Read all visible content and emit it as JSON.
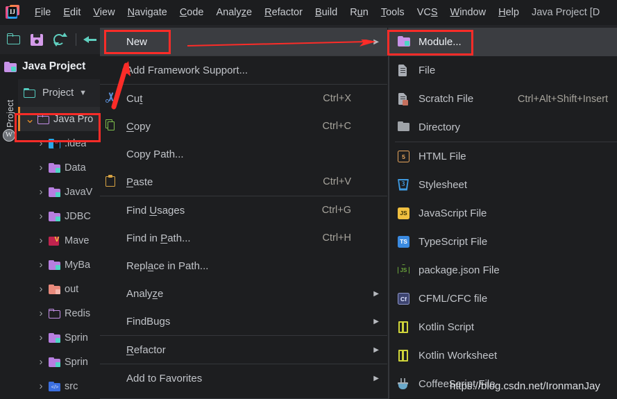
{
  "app": {
    "logo_icon": "intellij-idea-logo",
    "window_title": "Java Project [D"
  },
  "menubar": {
    "items": [
      {
        "label": "File",
        "mnemonic": "F"
      },
      {
        "label": "Edit",
        "mnemonic": "E"
      },
      {
        "label": "View",
        "mnemonic": "V"
      },
      {
        "label": "Navigate",
        "mnemonic": "N"
      },
      {
        "label": "Code",
        "mnemonic": "C"
      },
      {
        "label": "Analyze",
        "mnemonic": "z"
      },
      {
        "label": "Refactor",
        "mnemonic": "R"
      },
      {
        "label": "Build",
        "mnemonic": "B"
      },
      {
        "label": "Run",
        "mnemonic": "u"
      },
      {
        "label": "Tools",
        "mnemonic": "T"
      },
      {
        "label": "VCS",
        "mnemonic": "S"
      },
      {
        "label": "Window",
        "mnemonic": "W"
      },
      {
        "label": "Help",
        "mnemonic": "H"
      }
    ]
  },
  "toolbar": {
    "icons": [
      {
        "name": "open-folder-icon"
      },
      {
        "name": "save-all-icon"
      },
      {
        "name": "sync-refresh-icon"
      },
      {
        "name": "back-arrow-icon"
      }
    ]
  },
  "project_header": {
    "icon": "module-folder-icon",
    "label": "Java Project"
  },
  "left_strip": {
    "vertical_label": "1: Project",
    "avatar_icon": "user-avatar-icon"
  },
  "tree_toolbar": {
    "icon": "project-view-icon",
    "label": "Project",
    "chevron_icon": "chevron-down-icon"
  },
  "project_tree": {
    "rows": [
      {
        "label": "Java Pro",
        "icon": "folder-outline-purple",
        "expanded": true,
        "selected": true,
        "indent": 10
      },
      {
        "label": ".idea",
        "icon": "idea-folder",
        "expanded": false,
        "selected": false,
        "indent": 26
      },
      {
        "label": "Data",
        "icon": "folder-module-purple",
        "expanded": false,
        "selected": false,
        "indent": 26
      },
      {
        "label": "JavaV",
        "icon": "folder-module-purple",
        "expanded": false,
        "selected": false,
        "indent": 26
      },
      {
        "label": "JDBC",
        "icon": "folder-module-purple",
        "expanded": false,
        "selected": false,
        "indent": 26
      },
      {
        "label": "Mave",
        "icon": "maven-folder",
        "expanded": false,
        "selected": false,
        "indent": 26
      },
      {
        "label": "MyBa",
        "icon": "folder-module-purple",
        "expanded": false,
        "selected": false,
        "indent": 26
      },
      {
        "label": "out",
        "icon": "folder-out-salmon",
        "expanded": false,
        "selected": false,
        "indent": 26
      },
      {
        "label": "Redis",
        "icon": "folder-outline-purple",
        "expanded": false,
        "selected": false,
        "indent": 26
      },
      {
        "label": "Sprin",
        "icon": "folder-module-purple",
        "expanded": false,
        "selected": false,
        "indent": 26
      },
      {
        "label": "Sprin",
        "icon": "folder-module-purple",
        "expanded": false,
        "selected": false,
        "indent": 26
      },
      {
        "label": "src",
        "icon": "folder-source-blue",
        "expanded": false,
        "selected": false,
        "indent": 26
      }
    ]
  },
  "context_menu": {
    "items": [
      {
        "label": "New",
        "icon": null,
        "shortcut": "",
        "submenu": true,
        "highlighted": true,
        "sep_after": true,
        "mnemonic": ""
      },
      {
        "label": "Add Framework Support...",
        "icon": null,
        "shortcut": "",
        "submenu": false,
        "highlighted": false,
        "sep_after": true,
        "mnemonic": ""
      },
      {
        "label": "Cut",
        "icon": "cut-icon",
        "shortcut": "Ctrl+X",
        "submenu": false,
        "highlighted": false,
        "sep_after": false,
        "mnemonic": "t"
      },
      {
        "label": "Copy",
        "icon": "copy-icon",
        "shortcut": "Ctrl+C",
        "submenu": false,
        "highlighted": false,
        "sep_after": false,
        "mnemonic": "C"
      },
      {
        "label": "Copy Path...",
        "icon": null,
        "shortcut": "",
        "submenu": false,
        "highlighted": false,
        "sep_after": false,
        "mnemonic": ""
      },
      {
        "label": "Paste",
        "icon": "paste-icon",
        "shortcut": "Ctrl+V",
        "submenu": false,
        "highlighted": false,
        "sep_after": true,
        "mnemonic": "P"
      },
      {
        "label": "Find Usages",
        "icon": null,
        "shortcut": "Ctrl+G",
        "submenu": false,
        "highlighted": false,
        "sep_after": false,
        "mnemonic": "U"
      },
      {
        "label": "Find in Path...",
        "icon": null,
        "shortcut": "Ctrl+H",
        "submenu": false,
        "highlighted": false,
        "sep_after": false,
        "mnemonic": "P"
      },
      {
        "label": "Replace in Path...",
        "icon": null,
        "shortcut": "",
        "submenu": false,
        "highlighted": false,
        "sep_after": false,
        "mnemonic": "a"
      },
      {
        "label": "Analyze",
        "icon": null,
        "shortcut": "",
        "submenu": true,
        "highlighted": false,
        "sep_after": false,
        "mnemonic": "z"
      },
      {
        "label": "FindBugs",
        "icon": null,
        "shortcut": "",
        "submenu": true,
        "highlighted": false,
        "sep_after": true,
        "mnemonic": ""
      },
      {
        "label": "Refactor",
        "icon": null,
        "shortcut": "",
        "submenu": true,
        "highlighted": false,
        "sep_after": true,
        "mnemonic": "R"
      },
      {
        "label": "Add to Favorites",
        "icon": null,
        "shortcut": "",
        "submenu": true,
        "highlighted": false,
        "sep_after": false,
        "mnemonic": ""
      }
    ]
  },
  "new_submenu": {
    "items": [
      {
        "label": "Module...",
        "icon": "module-folder-icon",
        "shortcut": "",
        "highlighted": true,
        "sep_after": false
      },
      {
        "label": "File",
        "icon": "file-icon",
        "shortcut": "",
        "highlighted": false,
        "sep_after": false
      },
      {
        "label": "Scratch File",
        "icon": "scratch-file-icon",
        "shortcut": "Ctrl+Alt+Shift+Insert",
        "highlighted": false,
        "sep_after": false
      },
      {
        "label": "Directory",
        "icon": "directory-icon",
        "shortcut": "",
        "highlighted": false,
        "sep_after": true
      },
      {
        "label": "HTML File",
        "icon": "html5-icon",
        "shortcut": "",
        "highlighted": false,
        "sep_after": false
      },
      {
        "label": "Stylesheet",
        "icon": "css3-icon",
        "shortcut": "",
        "highlighted": false,
        "sep_after": false
      },
      {
        "label": "JavaScript File",
        "icon": "javascript-icon",
        "shortcut": "",
        "highlighted": false,
        "sep_after": false
      },
      {
        "label": "TypeScript File",
        "icon": "typescript-icon",
        "shortcut": "",
        "highlighted": false,
        "sep_after": false
      },
      {
        "label": "package.json File",
        "icon": "nodejs-icon",
        "shortcut": "",
        "highlighted": false,
        "sep_after": false
      },
      {
        "label": "CFML/CFC file",
        "icon": "coldfusion-icon",
        "shortcut": "",
        "highlighted": false,
        "sep_after": false
      },
      {
        "label": "Kotlin Script",
        "icon": "kotlin-icon",
        "shortcut": "",
        "highlighted": false,
        "sep_after": false
      },
      {
        "label": "Kotlin Worksheet",
        "icon": "kotlin-icon",
        "shortcut": "",
        "highlighted": false,
        "sep_after": false
      },
      {
        "label": "CoffeeScript File",
        "icon": "coffeescript-icon",
        "shortcut": "",
        "highlighted": false,
        "sep_after": false
      }
    ]
  },
  "annotations": {
    "color": "#fc2c28",
    "boxes": [
      {
        "name": "new-menu-item-box"
      },
      {
        "name": "module-menu-item-box"
      },
      {
        "name": "project-tree-root-box"
      }
    ],
    "arrows": [
      {
        "name": "new-to-module-arrow"
      },
      {
        "name": "pointer-to-new-arrow"
      }
    ]
  },
  "watermark": {
    "text": "https://blog.csdn.net/IronmanJay"
  }
}
